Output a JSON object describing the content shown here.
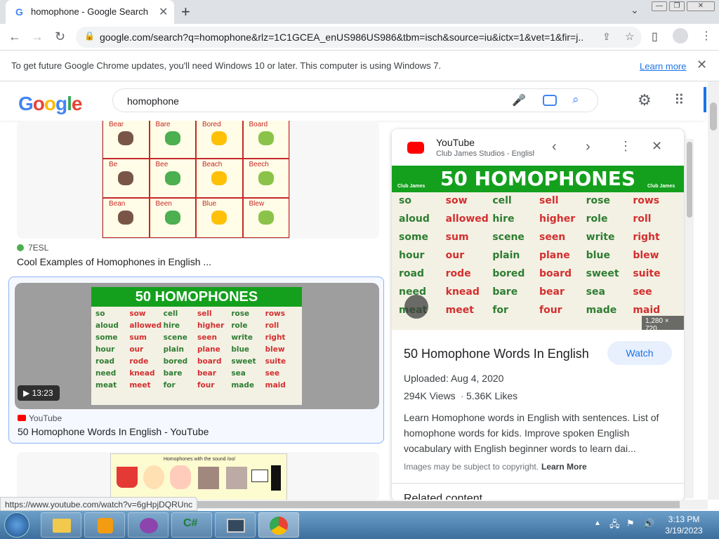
{
  "browser": {
    "tab_title": "homophone - Google Search",
    "tab_close": "✕",
    "new_tab": "+",
    "url": "google.com/search?q=homophone&rlz=1C1GCEA_enUS986US986&tbm=isch&source=iu&ictx=1&vet=1&fir=j...",
    "favicon": "G"
  },
  "infobar": {
    "text": "To get future Google Chrome updates, you'll need Windows 10 or later. This computer is using Windows 7.",
    "learn_more": "Learn more"
  },
  "search": {
    "query": "homophone"
  },
  "results": [
    {
      "source": "7ESL",
      "title": "Cool Examples of Homophones in English ..."
    },
    {
      "source": "YouTube",
      "title": "50 Homophone Words In English - YouTube",
      "duration": "13:23"
    }
  ],
  "chart_words": {
    "banner": "50 HOMOPHONES",
    "club": "Club James",
    "rows": [
      [
        "so",
        "sow",
        "cell",
        "sell",
        "rose",
        "rows"
      ],
      [
        "aloud",
        "allowed",
        "hire",
        "higher",
        "role",
        "roll"
      ],
      [
        "some",
        "sum",
        "scene",
        "seen",
        "write",
        "right"
      ],
      [
        "hour",
        "our",
        "plain",
        "plane",
        "blue",
        "blew"
      ],
      [
        "road",
        "rode",
        "bored",
        "board",
        "sweet",
        "suite"
      ],
      [
        "need",
        "knead",
        "bare",
        "bear",
        "sea",
        "see"
      ],
      [
        "meat",
        "meet",
        "for",
        "four",
        "made",
        "maid"
      ]
    ]
  },
  "top_tile_words": [
    "Bear",
    "Bare",
    "Bored",
    "Board",
    "Be",
    "Bee",
    "Beach",
    "Beech",
    "Bean",
    "Been",
    "Blue",
    "Blew"
  ],
  "bottom_tile_heading": "Homophones with the sound /oo/",
  "panel": {
    "source": "YouTube",
    "channel": "Club James Studios - English",
    "dimensions": "1,280 × 720",
    "title": "50 Homophone Words In English",
    "watch": "Watch",
    "uploaded": "Uploaded: Aug 4, 2020",
    "views": "294K Views",
    "likes": "5.36K Likes",
    "description": "Learn Homophone words in English with sentences. List of homophone words for kids. Improve spoken English vocabulary with English beginner words to learn dai...",
    "copyright": "Images may be subject to copyright.",
    "copyright_link": "Learn More",
    "related": "Related content"
  },
  "status_url": "https://www.youtube.com/watch?v=6gHpjDQRUnc",
  "clock": {
    "time": "3:13 PM",
    "date": "3/19/2023"
  },
  "colors": {
    "accent": "#1a73e8",
    "green_header": "#14a01d",
    "red_word": "#d32f2f",
    "green_word": "#2e7d32"
  }
}
